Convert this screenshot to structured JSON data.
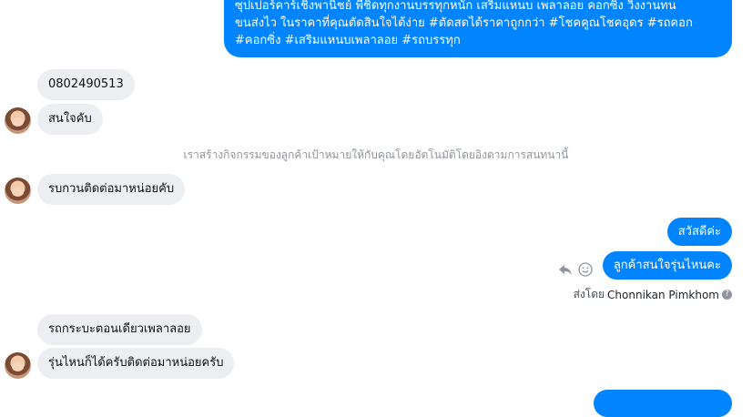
{
  "messages": {
    "top_outgoing": {
      "lines": [
        "ซุปเปอร์คาร์เชิงพานิชย์ พี่ชิดทุกงานบรรทุกหนัก เสริมแหนบ เพลาลอย คอกซิ่ง วิ่งงานทน",
        "ขนส่งไว ในราคาที่คุณตัดสินใจได้ง่าย #ตัดสดได้ราคาถูกกว่า #โชคคูณโชคอุดร #รถคอก",
        "#คอกซิ่ง #เสริมแหนบเพลาลอย #รถบรรทุก"
      ]
    },
    "incoming_phone": "0802490513",
    "incoming_interest": "สนใจคับ",
    "system_note": "เราสร้างกิจกรรมของลูกค้าเป้าหมายให้กับคุณโดยอัตโนมัติโดยอิงตามการสนทนานี้",
    "incoming_contact": "รบกวนติดต่อมาหน่อยคับ",
    "outgoing_greeting": "สวัสดีค่ะ",
    "outgoing_question": "ลูกค้าสนใจรุ่นไหนคะ",
    "sent_by_prefix": "ส่งโดย",
    "sent_by_name": "Chonnikan Pimkhom",
    "help_icon": "?",
    "incoming_model": "รถกระบะตอนเดียวเพลาลอย",
    "incoming_any": "รุ่นไหนก็ได้ครับติดต่อมาหน่อยครับ"
  },
  "icons": {
    "reply": "reply-icon",
    "emoji": "smiley-icon",
    "avatar": "contact-avatar"
  },
  "colors": {
    "outgoing_bubble": "#0084ff",
    "incoming_bubble": "#eceef1"
  }
}
